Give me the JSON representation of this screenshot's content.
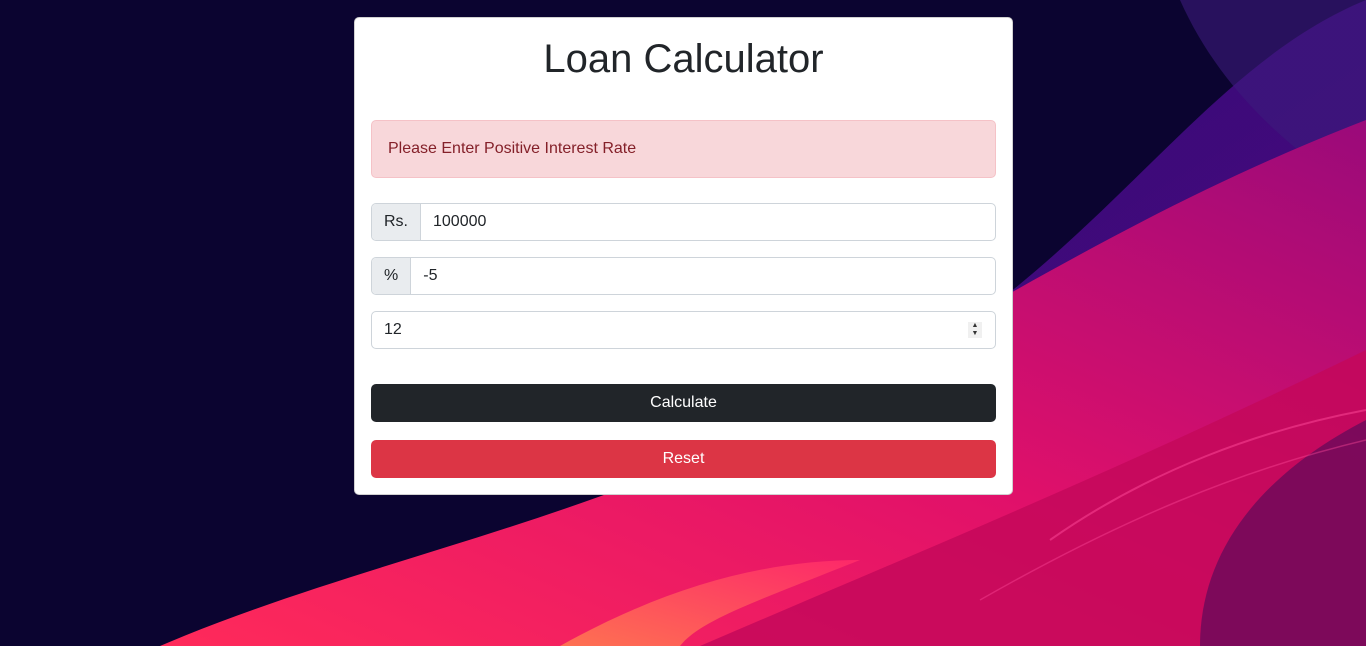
{
  "page": {
    "title": "Loan Calculator"
  },
  "alert": {
    "message": "Please Enter Positive Interest Rate",
    "type": "danger"
  },
  "form": {
    "amount": {
      "prefix": "Rs.",
      "value": "100000"
    },
    "interest": {
      "prefix": "%",
      "value": "-5"
    },
    "years": {
      "value": "12"
    }
  },
  "buttons": {
    "calculate_label": "Calculate",
    "reset_label": "Reset"
  },
  "colors": {
    "background": "#0b0430",
    "card": "#ffffff",
    "alert_bg": "#f8d7da",
    "alert_text": "#842029",
    "calculate_bg": "#212529",
    "reset_bg": "#dc3545"
  }
}
